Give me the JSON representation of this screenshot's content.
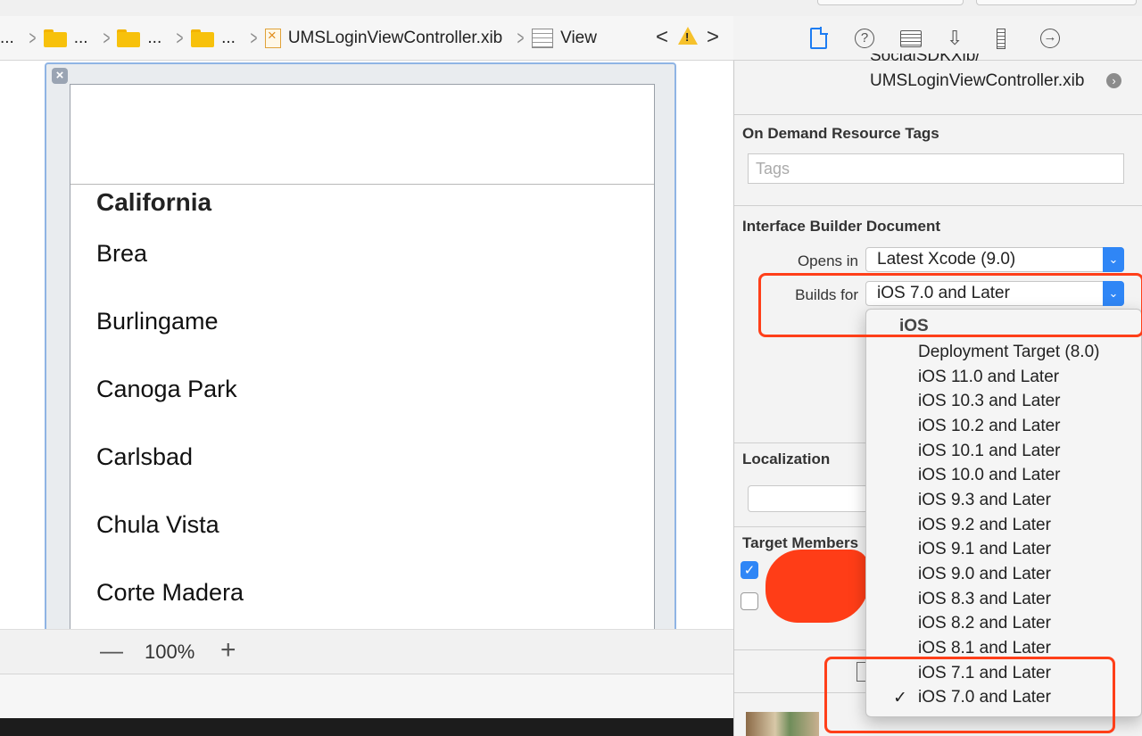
{
  "jumpbar": {
    "folders": [
      "...",
      "...",
      "...",
      "..."
    ],
    "file": "UMSLoginViewController.xib",
    "view": "View"
  },
  "canvas": {
    "section_title": "California",
    "cities": [
      "Brea",
      "Burlingame",
      "Canoga Park",
      "Carlsbad",
      "Chula Vista",
      "Corte Madera"
    ],
    "zoom": "100%"
  },
  "inspector": {
    "path_partial": "SocialSDKXib/",
    "path_file": "UMSLoginViewController.xib",
    "on_demand_title": "On Demand Resource Tags",
    "tags_placeholder": "Tags",
    "ib_document_title": "Interface Builder Document",
    "opens_in_label": "Opens in",
    "opens_in_value": "Latest Xcode (9.0)",
    "builds_for_label": "Builds for",
    "builds_for_value": "iOS 7.0 and Later",
    "localization_title": "Localization",
    "target_membership_title": "Target Members"
  },
  "menu": {
    "header": "iOS",
    "items": [
      "Deployment Target (8.0)",
      "iOS 11.0 and Later",
      "iOS 10.3 and Later",
      "iOS 10.2 and Later",
      "iOS 10.1 and Later",
      "iOS 10.0 and Later",
      "iOS 9.3 and Later",
      "iOS 9.2 and Later",
      "iOS 9.1 and Later",
      "iOS 9.0 and Later",
      "iOS 8.3 and Later",
      "iOS 8.2 and Later",
      "iOS 8.1 and Later",
      "iOS 7.1 and Later",
      "iOS 7.0 and Later"
    ],
    "selected": "iOS 7.0 and Later"
  },
  "colors": {
    "accent_blue": "#2f86f6",
    "annotation_red": "#ff3f19",
    "warning_yellow": "#f6c12b"
  }
}
